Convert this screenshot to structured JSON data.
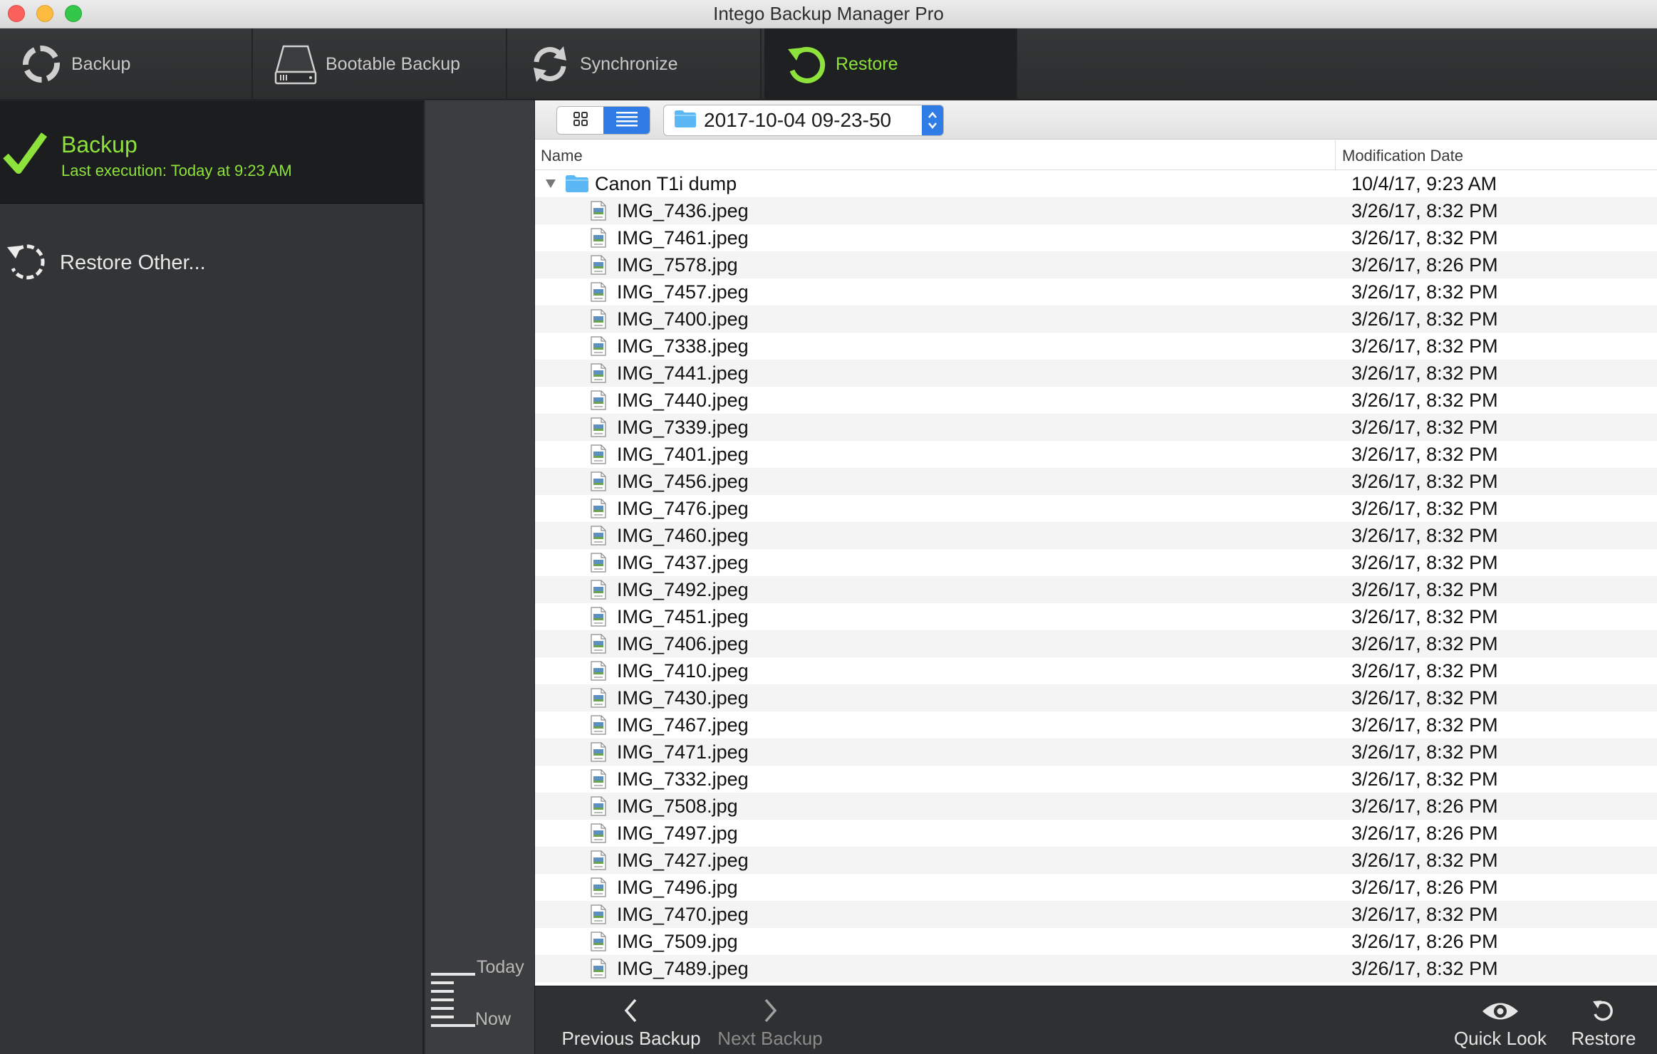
{
  "window": {
    "title": "Intego Backup Manager Pro"
  },
  "toolbar": {
    "tabs": [
      {
        "label": "Backup",
        "icon": "backup-ring-icon",
        "active": false
      },
      {
        "label": "Bootable Backup",
        "icon": "hard-drive-icon",
        "active": false
      },
      {
        "label": "Synchronize",
        "icon": "sync-arrows-icon",
        "active": false
      },
      {
        "label": "Restore",
        "icon": "restore-arrow-icon",
        "active": true
      }
    ]
  },
  "sidebar": {
    "backup": {
      "title": "Backup",
      "subtitle": "Last execution: Today at 9:23 AM"
    },
    "restore_other": {
      "label": "Restore Other..."
    }
  },
  "timeline": {
    "top_label": "Today",
    "bottom_label": "Now"
  },
  "browser": {
    "path": "2017-10-04 09-23-50",
    "columns": {
      "name": "Name",
      "date": "Modification Date"
    },
    "folder": {
      "name": "Canon T1i dump",
      "date": "10/4/17, 9:23 AM"
    },
    "files": [
      {
        "name": "IMG_7436.jpeg",
        "date": "3/26/17, 8:32 PM"
      },
      {
        "name": "IMG_7461.jpeg",
        "date": "3/26/17, 8:32 PM"
      },
      {
        "name": "IMG_7578.jpg",
        "date": "3/26/17, 8:26 PM"
      },
      {
        "name": "IMG_7457.jpeg",
        "date": "3/26/17, 8:32 PM"
      },
      {
        "name": "IMG_7400.jpeg",
        "date": "3/26/17, 8:32 PM"
      },
      {
        "name": "IMG_7338.jpeg",
        "date": "3/26/17, 8:32 PM"
      },
      {
        "name": "IMG_7441.jpeg",
        "date": "3/26/17, 8:32 PM"
      },
      {
        "name": "IMG_7440.jpeg",
        "date": "3/26/17, 8:32 PM"
      },
      {
        "name": "IMG_7339.jpeg",
        "date": "3/26/17, 8:32 PM"
      },
      {
        "name": "IMG_7401.jpeg",
        "date": "3/26/17, 8:32 PM"
      },
      {
        "name": "IMG_7456.jpeg",
        "date": "3/26/17, 8:32 PM"
      },
      {
        "name": "IMG_7476.jpeg",
        "date": "3/26/17, 8:32 PM"
      },
      {
        "name": "IMG_7460.jpeg",
        "date": "3/26/17, 8:32 PM"
      },
      {
        "name": "IMG_7437.jpeg",
        "date": "3/26/17, 8:32 PM"
      },
      {
        "name": "IMG_7492.jpeg",
        "date": "3/26/17, 8:32 PM"
      },
      {
        "name": "IMG_7451.jpeg",
        "date": "3/26/17, 8:32 PM"
      },
      {
        "name": "IMG_7406.jpeg",
        "date": "3/26/17, 8:32 PM"
      },
      {
        "name": "IMG_7410.jpeg",
        "date": "3/26/17, 8:32 PM"
      },
      {
        "name": "IMG_7430.jpeg",
        "date": "3/26/17, 8:32 PM"
      },
      {
        "name": "IMG_7467.jpeg",
        "date": "3/26/17, 8:32 PM"
      },
      {
        "name": "IMG_7471.jpeg",
        "date": "3/26/17, 8:32 PM"
      },
      {
        "name": "IMG_7332.jpeg",
        "date": "3/26/17, 8:32 PM"
      },
      {
        "name": "IMG_7508.jpg",
        "date": "3/26/17, 8:26 PM"
      },
      {
        "name": "IMG_7497.jpg",
        "date": "3/26/17, 8:26 PM"
      },
      {
        "name": "IMG_7427.jpeg",
        "date": "3/26/17, 8:32 PM"
      },
      {
        "name": "IMG_7496.jpg",
        "date": "3/26/17, 8:26 PM"
      },
      {
        "name": "IMG_7470.jpeg",
        "date": "3/26/17, 8:32 PM"
      },
      {
        "name": "IMG_7509.jpg",
        "date": "3/26/17, 8:26 PM"
      },
      {
        "name": "IMG_7489.jpeg",
        "date": "3/26/17, 8:32 PM"
      }
    ]
  },
  "bottombar": {
    "previous": "Previous Backup",
    "next": "Next Backup",
    "quicklook": "Quick Look",
    "restore": "Restore"
  },
  "colors": {
    "accent_green": "#8de23b",
    "selection_blue": "#2f7ce6",
    "folder_blue": "#5cb8f5"
  }
}
